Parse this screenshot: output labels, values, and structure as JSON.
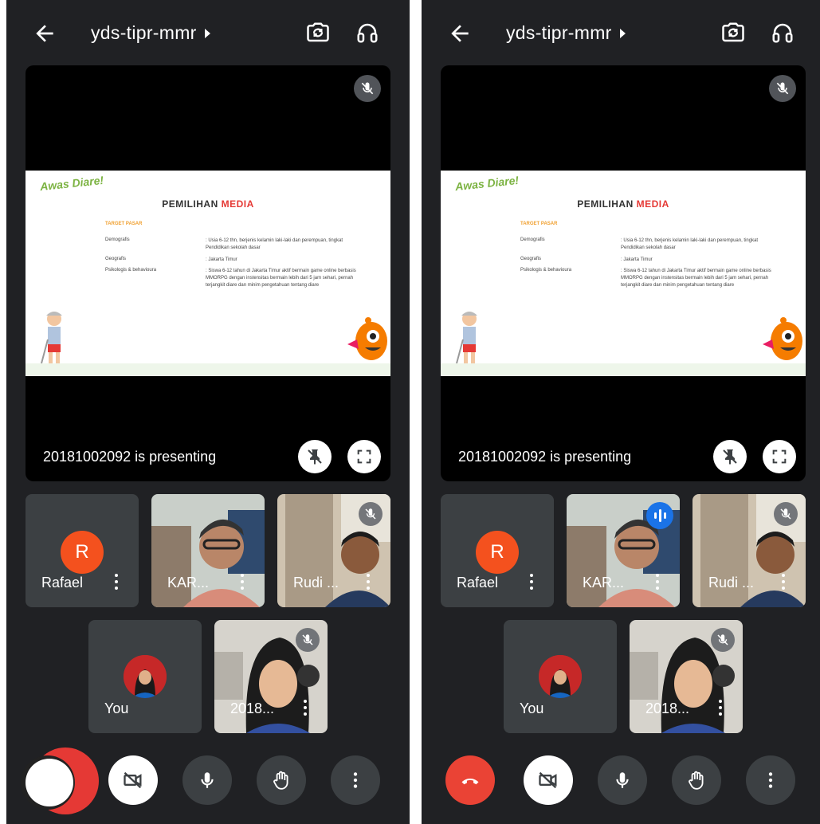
{
  "meeting_code": "yds-tipr-mmr",
  "slide": {
    "logo_text": "Awas Diare!",
    "title_main": "PEMILIHAN ",
    "title_accent": "MEDIA",
    "section": "TARGET PASAR",
    "rows": [
      {
        "key": "Demografis",
        "value": ": Usia 6-12 thn, berjenis kelamin laki-laki dan perempuan, tingkat Pendidikan sekolah dasar"
      },
      {
        "key": "Geografis",
        "value": ": Jakarta Timur"
      },
      {
        "key": "Psikologis & behavioura",
        "value": ": Siswa 6-12 tahun di Jakarta Timur aktif bermain game online berbasis MMORPG dengan instensitas bermain lebih dari 5 jam sehari, pernah terjangkit diare dan minim pengetahuan tentang diare"
      }
    ]
  },
  "presenting_label": "20181002092 is presenting",
  "participants": {
    "rafael": {
      "name": "Rafael",
      "initial": "R"
    },
    "kar": {
      "name": "KAR..."
    },
    "rudi": {
      "name": "Rudi ..."
    },
    "you": {
      "name": "You"
    },
    "student": {
      "name": "2018..."
    }
  },
  "colors": {
    "background": "#202124",
    "tile": "#3c4043",
    "avatar_orange": "#f4511e",
    "end_call_red": "#ea4335",
    "speaking_blue": "#1a73e8",
    "slide_accent": "#e53935"
  },
  "icons": {
    "back": "arrow-left-icon",
    "rotate_camera": "camera-rotate-icon",
    "audio": "headphones-icon",
    "mute": "mic-off-icon",
    "pin": "pin-off-icon",
    "fullscreen": "fullscreen-icon",
    "more": "more-vertical-icon",
    "camera_off": "video-off-icon",
    "mic": "mic-icon",
    "hand": "raise-hand-icon",
    "end_call": "call-end-icon"
  }
}
